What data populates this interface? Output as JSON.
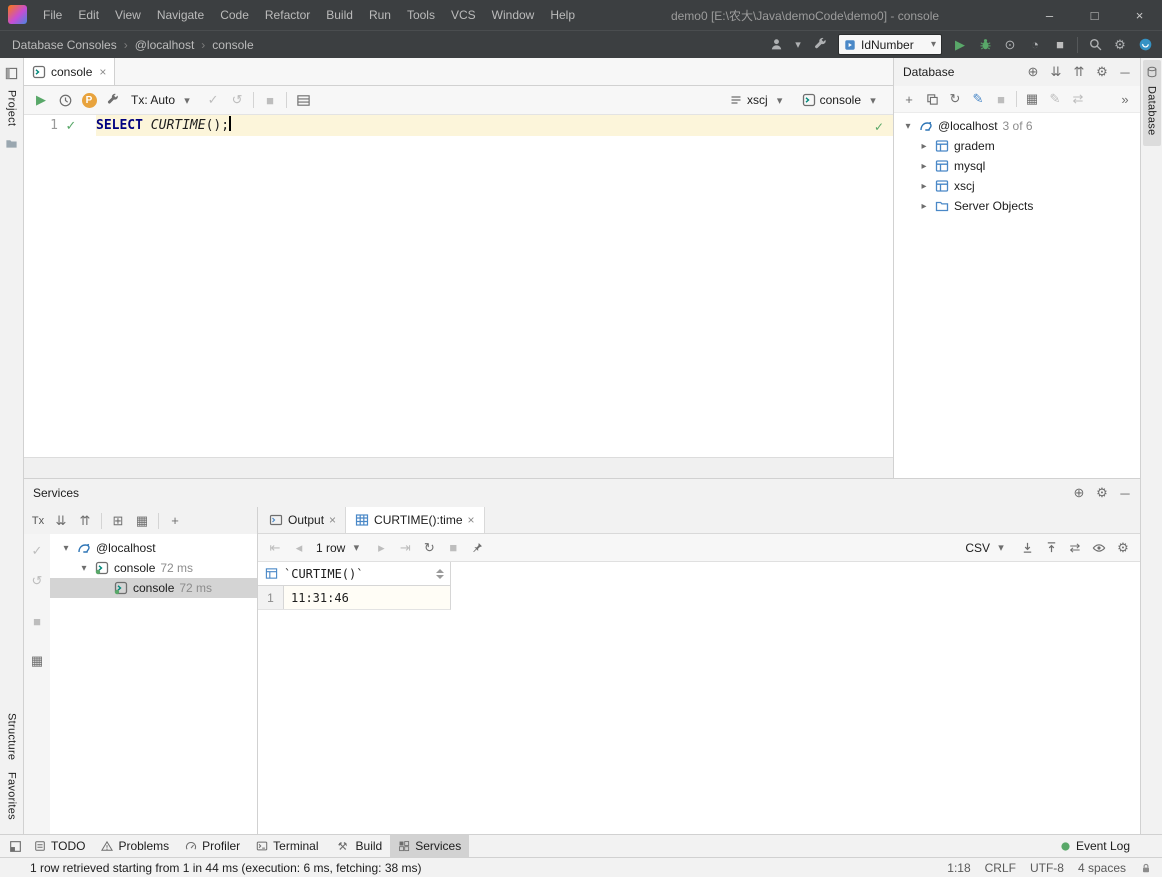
{
  "icons": {
    "minimize": "–",
    "maximize": "□",
    "close": "×",
    "chevron_down": "▾",
    "chevron_right": "▸",
    "breadcrumb_sep": "›",
    "play": "▶",
    "check": "✓",
    "rollback": "↺",
    "stop": "■",
    "refresh": "↻",
    "locate": "⊕",
    "expand_all": "⇊",
    "collapse_all": "⇈",
    "gear": "⚙",
    "hide": "─",
    "add": "+",
    "more": "»",
    "coverage": "⊙",
    "profiler": "◔",
    "first_page": "⇤",
    "prev_page": "◂",
    "next_page": "▸",
    "last_page": "⇥",
    "swap": "⇄",
    "parameters": "P",
    "tx": "Tx",
    "group_a": "⊞",
    "group_b": "▦",
    "hammer": "⚒",
    "pencil": "✎"
  },
  "title_bar": {
    "title": "demo0 [E:\\农大\\Java\\demoCode\\demo0] - console",
    "menus": [
      "File",
      "Edit",
      "View",
      "Navigate",
      "Code",
      "Refactor",
      "Build",
      "Run",
      "Tools",
      "VCS",
      "Window",
      "Help"
    ]
  },
  "header_toolbar": {
    "breadcrumbs": [
      "Database Consoles",
      "@localhost",
      "console"
    ],
    "run_config": "IdNumber"
  },
  "stripes": {
    "project": "Project",
    "structure": "Structure",
    "favorites": "Favorites",
    "database": "Database"
  },
  "editor": {
    "tab": "console",
    "tx_mode": "Tx: Auto",
    "schema_selector": "xscj",
    "console_selector": "console",
    "line_number": "1",
    "code": {
      "keyword": "SELECT ",
      "function": "CURTIME",
      "rest": "();"
    }
  },
  "database_panel": {
    "title": "Database",
    "root_label": "@localhost",
    "root_badge": "3 of 6",
    "schemas": [
      "gradem",
      "mysql",
      "xscj"
    ],
    "server_objects": "Server Objects"
  },
  "services_panel": {
    "title": "Services",
    "tree": {
      "root": "@localhost",
      "child": "console",
      "child_time": "72 ms",
      "leaf": "console",
      "leaf_time": "72 ms"
    },
    "tabs": {
      "output": "Output",
      "result": "CURTIME():time"
    },
    "result_toolbar": {
      "pager": "1 row",
      "format": "CSV"
    },
    "grid": {
      "column": "`CURTIME()`",
      "row_number": "1",
      "value": "11:31:46"
    }
  },
  "bottom_bar": {
    "items": [
      "TODO",
      "Problems",
      "Profiler",
      "Terminal",
      "Build",
      "Services"
    ],
    "event_log": "Event Log"
  },
  "status_bar": {
    "message": "1 row retrieved starting from 1 in 44 ms (execution: 6 ms, fetching: 38 ms)",
    "caret": "1:18",
    "line_separator": "CRLF",
    "encoding": "UTF-8",
    "indent": "4 spaces"
  }
}
